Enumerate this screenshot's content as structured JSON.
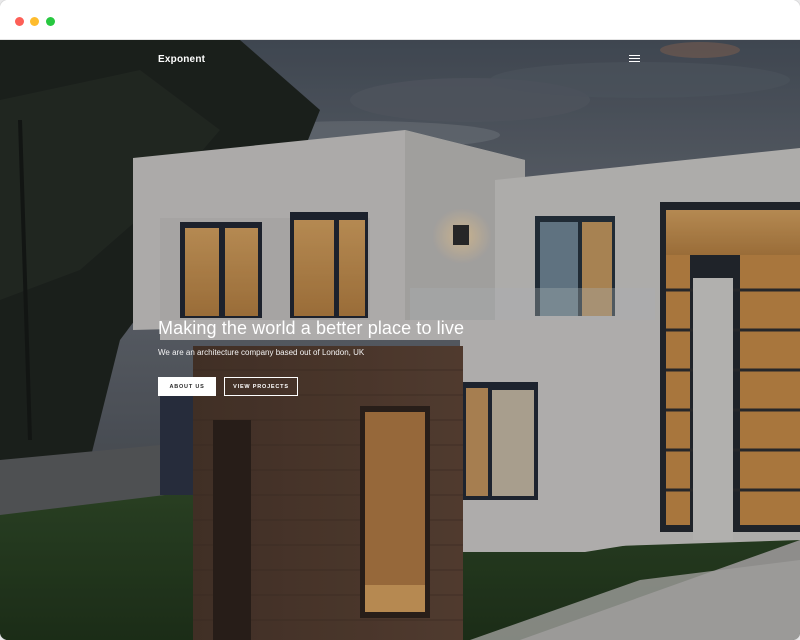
{
  "navbar": {
    "brand": "Exponent",
    "menu_icon": "hamburger-icon"
  },
  "hero": {
    "headline": "Making the world a better place to live",
    "subheadline": "We are an architecture company based out of London, UK",
    "primary_button": "ABOUT US",
    "secondary_button": "VIEW PROJECTS"
  },
  "window_controls": [
    "close",
    "minimize",
    "maximize"
  ],
  "colors": {
    "close": "#fd5f57",
    "minimize": "#febc2e",
    "maximize": "#28c840",
    "text": "#ffffff"
  }
}
